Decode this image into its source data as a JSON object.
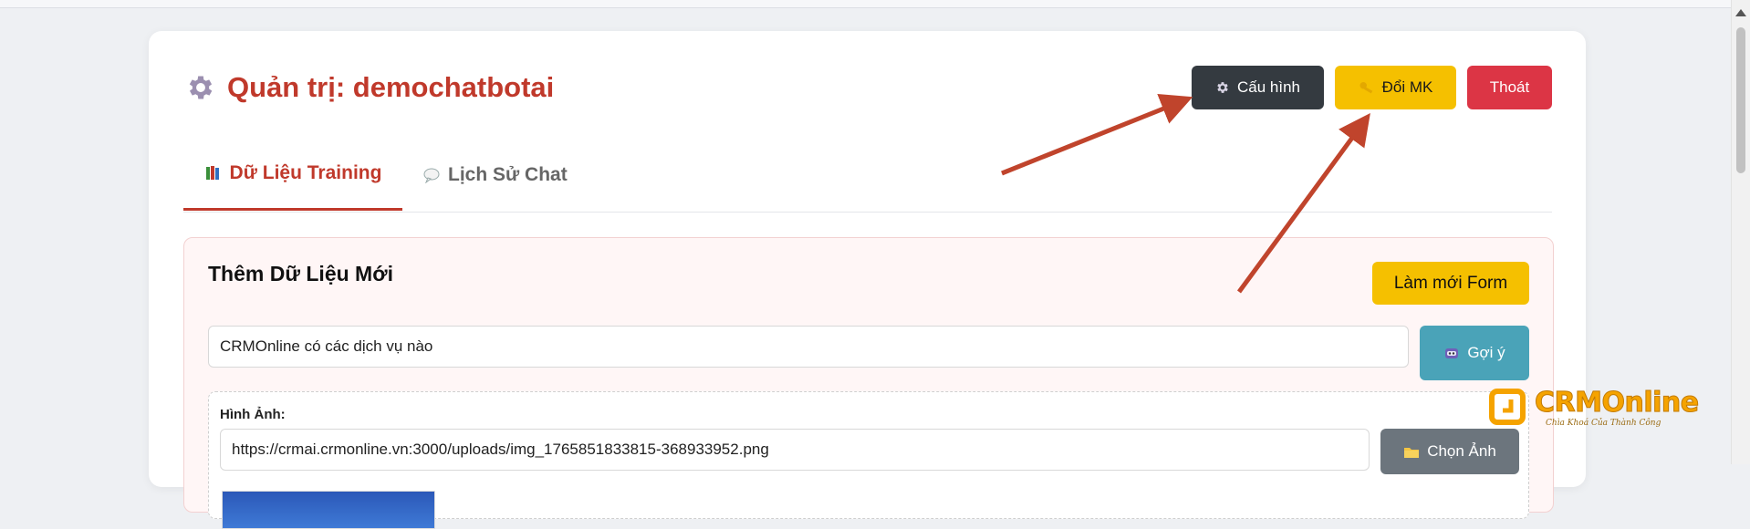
{
  "header": {
    "title": "Quản trị: demochatbotai",
    "buttons": {
      "config": "Cấu hình",
      "change_password": "Đổi MK",
      "logout": "Thoát"
    }
  },
  "tabs": [
    {
      "label": "Dữ Liệu Training",
      "active": true
    },
    {
      "label": "Lịch Sử Chat",
      "active": false
    }
  ],
  "form": {
    "title": "Thêm Dữ Liệu Mới",
    "refresh_label": "Làm mới Form",
    "question_value": "CRMOnline có các dịch vụ nào",
    "suggest_label": "Gợi ý",
    "image_label": "Hình Ảnh:",
    "image_url_value": "https://crmai.crmonline.vn:3000/uploads/img_1765851833815-368933952.png",
    "choose_image_label": "Chọn Ảnh"
  },
  "watermark": {
    "brand": "CRMOnline",
    "tagline": "Chìa Khoá Của Thành Công"
  },
  "colors": {
    "title_red": "#c0392b",
    "dark_button": "#343a40",
    "yellow_button": "#f5c000",
    "red_button": "#dc3545",
    "teal_button": "#4aa3b8",
    "gray_button": "#6c757d",
    "arrow": "#c0442c",
    "logo_orange": "#f5a300"
  },
  "icons": [
    "gear-icon",
    "key-icon",
    "books-icon",
    "speech-bubble-icon",
    "robot-icon",
    "folder-icon",
    "scroll-up-icon"
  ]
}
